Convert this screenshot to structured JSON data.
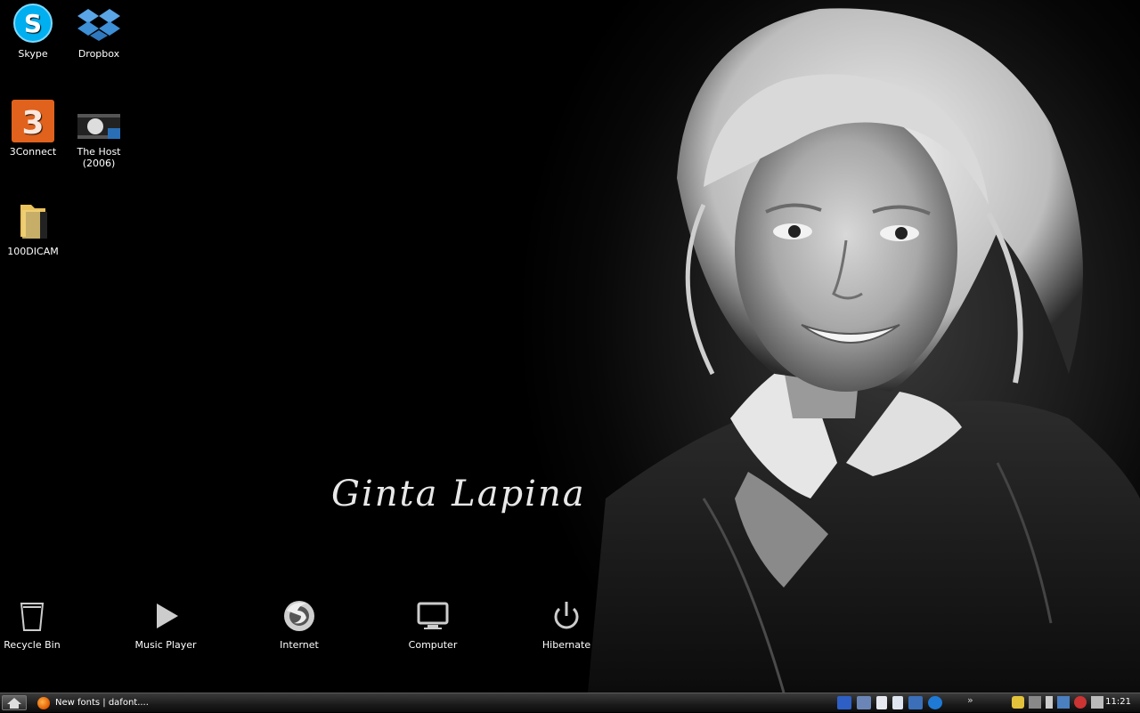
{
  "desktop": {
    "icons": [
      {
        "label": "Skype",
        "icon": "skype-icon"
      },
      {
        "label": "Dropbox",
        "icon": "dropbox-icon"
      },
      {
        "label": "3Connect",
        "icon": "three-connect-icon"
      },
      {
        "label": "The Host (2006)",
        "line1": "The Host",
        "line2": "(2006)",
        "icon": "movie-file-icon"
      },
      {
        "label": "100DICAM",
        "icon": "folder-icon"
      }
    ]
  },
  "wallpaper": {
    "signature": "Ginta Lapina"
  },
  "dock": {
    "items": [
      {
        "label": "Recycle Bin",
        "icon": "recycle-bin-icon"
      },
      {
        "label": "Music Player",
        "icon": "play-icon"
      },
      {
        "label": "Internet",
        "icon": "firefox-icon"
      },
      {
        "label": "Computer",
        "icon": "monitor-icon"
      },
      {
        "label": "Hibernate",
        "icon": "power-icon"
      }
    ]
  },
  "taskbar": {
    "task_label": "New fonts | dafont....",
    "chevron": "»",
    "clock": "11:21"
  },
  "colors": {
    "skype": "#00aff0",
    "dropbox": "#3d8fd6",
    "three": "#e0621c",
    "folder": "#e9c25c"
  }
}
